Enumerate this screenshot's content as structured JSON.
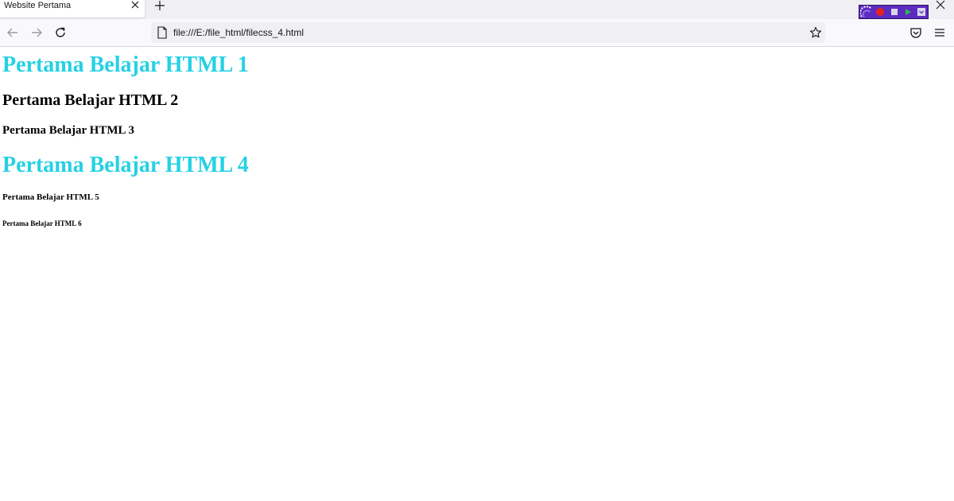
{
  "browser": {
    "tab": {
      "title": "Website Pertama",
      "close_icon": "close-icon"
    },
    "new_tab_icon": "plus-icon",
    "window_close_icon": "close-icon",
    "urlbar": {
      "url": "file:///E:/file_html/filecss_4.html"
    },
    "colors": {
      "tabstrip": "#f0f0f4",
      "navbar": "#f9f9fb",
      "recorder": "#5c2bc2",
      "record": "#e8221b",
      "play": "#2fb84a"
    }
  },
  "page": {
    "headings": [
      {
        "level": 1,
        "text": "Pertama Belajar HTML 1",
        "color": "#25d1e4"
      },
      {
        "level": 2,
        "text": "Pertama Belajar HTML 2",
        "color": "#000000"
      },
      {
        "level": 3,
        "text": "Pertama Belajar HTML 3",
        "color": "#000000"
      },
      {
        "level": 4,
        "text": "Pertama Belajar HTML 4",
        "color": "#25d1e4"
      },
      {
        "level": 5,
        "text": "Pertama Belajar HTML 5",
        "color": "#000000"
      },
      {
        "level": 6,
        "text": "Pertama Belajar HTML 6",
        "color": "#000000"
      }
    ]
  }
}
